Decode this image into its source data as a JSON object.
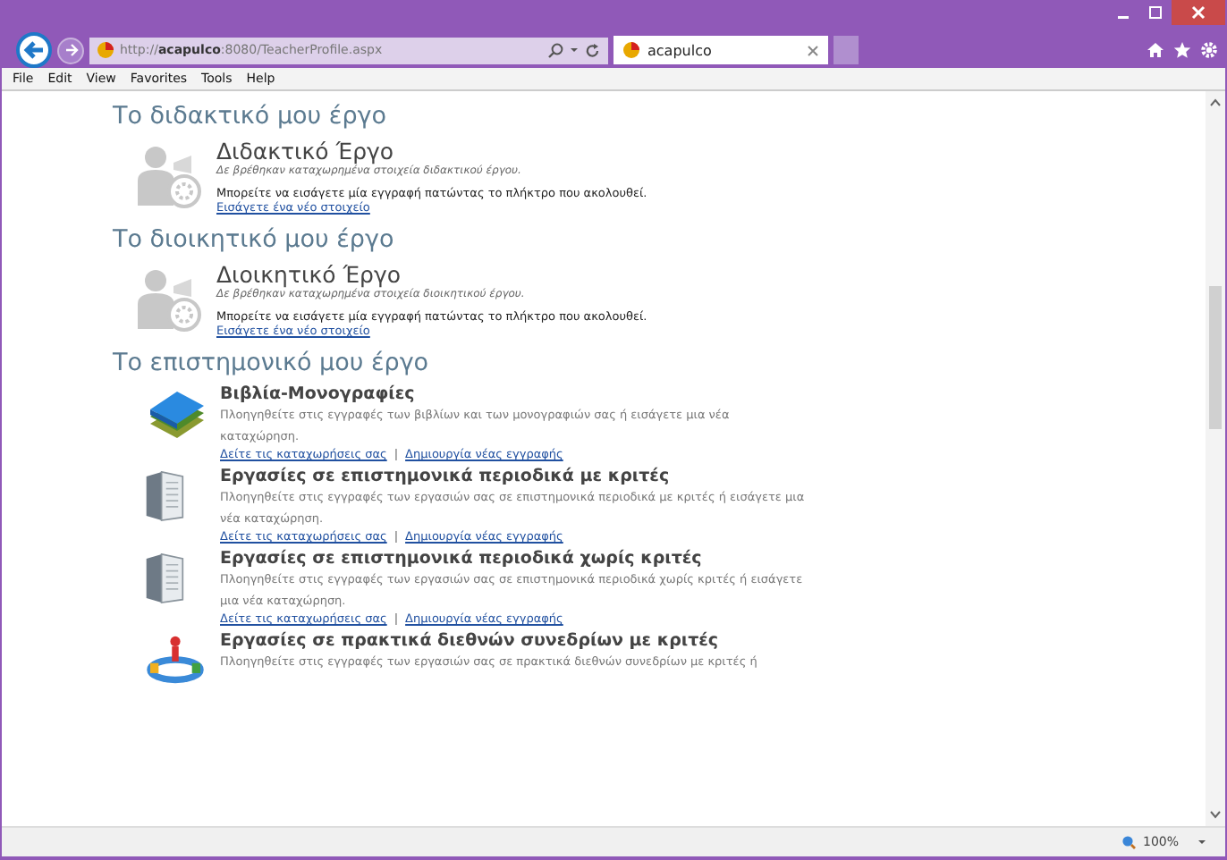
{
  "browser": {
    "address": {
      "prefix": "http://",
      "host": "acapulco",
      "rest": ":8080/TeacherProfile.aspx"
    },
    "tabs": [
      {
        "label": "acapulco",
        "selected": true
      }
    ],
    "menu": [
      "File",
      "Edit",
      "View",
      "Favorites",
      "Tools",
      "Help"
    ],
    "zoom": "100%"
  },
  "sections": [
    {
      "kind": "empty",
      "heading": "Το διδακτικό μου έργο",
      "title": "Διδακτικό Έργο",
      "note": "Δε βρέθηκαν καταχωρημένα στοιχεία διδακτικού έργου.",
      "hint": "Μπορείτε να εισάγετε μία εγγραφή πατώντας το πλήκτρο που ακολουθεί.",
      "link": "Εισάγετε ένα νέο στοιχείο"
    },
    {
      "kind": "empty",
      "heading": "Το διοικητικό μου έργο",
      "title": "Διοικητικό Έργο",
      "note": "Δε βρέθηκαν καταχωρημένα στοιχεία διοικητικού έργου.",
      "hint": "Μπορείτε να εισάγετε μία εγγραφή πατώντας το πλήκτρο που ακολουθεί.",
      "link": "Εισάγετε ένα νέο στοιχείο"
    },
    {
      "kind": "list",
      "heading": "Το επιστημονικό μου έργο",
      "items": [
        {
          "kind": "books",
          "title": "Βιβλία-Μονογραφίες",
          "desc": "Πλοηγηθείτε στις εγγραφές των βιβλίων και των μονογραφιών σας ή εισάγετε μια νέα καταχώρηση.",
          "links": [
            "Δείτε τις καταχωρήσεις σας",
            "Δημιουργία νέας εγγραφής"
          ],
          "separator": "|"
        },
        {
          "kind": "journal",
          "title": "Εργασίες σε επιστημονικά περιοδικά με κριτές",
          "desc": "Πλοηγηθείτε στις εγγραφές των εργασιών σας σε επιστημονικά περιοδικά με κριτές ή εισάγετε μια νέα καταχώρηση.",
          "links": [
            "Δείτε τις καταχωρήσεις σας",
            "Δημιουργία νέας εγγραφής"
          ],
          "separator": "|"
        },
        {
          "kind": "journal",
          "title": "Εργασίες σε επιστημονικά περιοδικά χωρίς κριτές",
          "desc": "Πλοηγηθείτε στις εγγραφές των εργασιών σας σε επιστημονικά περιοδικά χωρίς κριτές ή εισάγετε μια νέα καταχώρηση.",
          "links": [
            "Δείτε τις καταχωρήσεις σας",
            "Δημιουργία νέας εγγραφής"
          ],
          "separator": "|"
        },
        {
          "kind": "conference",
          "title": "Εργασίες σε πρακτικά διεθνών συνεδρίων με κριτές",
          "desc": "Πλοηγηθείτε στις εγγραφές των εργασιών σας σε πρακτικά διεθνών συνεδρίων με κριτές ή"
        }
      ]
    }
  ]
}
